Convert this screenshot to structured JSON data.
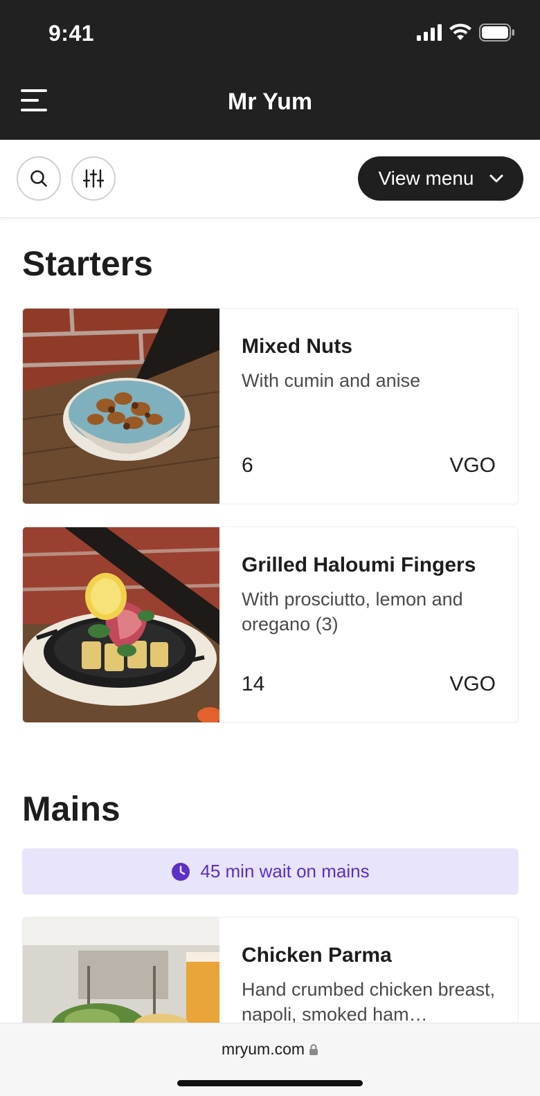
{
  "status_bar": {
    "time": "9:41"
  },
  "header": {
    "title": "Mr Yum"
  },
  "toolbar": {
    "view_menu_label": "View menu"
  },
  "sections": [
    {
      "title": "Starters",
      "items": [
        {
          "name": "Mixed Nuts",
          "description": "With cumin and anise",
          "price": "6",
          "tags": "VGO",
          "image": "bowl-of-nuts-photo"
        },
        {
          "name": "Grilled Haloumi Fingers",
          "description": "With prosciutto, lemon and oregano (3)",
          "price": "14",
          "tags": "VGO",
          "image": "haloumi-pan-photo"
        }
      ]
    },
    {
      "title": "Mains",
      "notice": "45 min wait on mains",
      "items": [
        {
          "name": "Chicken Parma",
          "description": "Hand crumbed chicken breast, napoli, smoked ham…",
          "image": "chicken-parma-photo"
        }
      ]
    }
  ],
  "browser": {
    "url": "mryum.com"
  },
  "colors": {
    "header_bg": "#212121",
    "notice_bg": "#e8e4fb",
    "notice_text": "#5b2fc9"
  }
}
